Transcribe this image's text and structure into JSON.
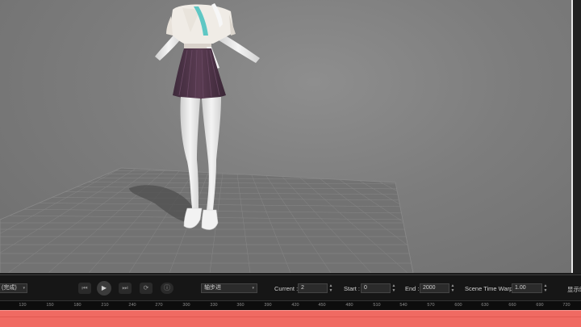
{
  "controls": {
    "mode_value": "(完成)",
    "interp_value": "轴步进",
    "current_label": "Current :",
    "current_value": "2",
    "start_label": "Start :",
    "start_value": "0",
    "end_label": "End :",
    "end_value": "2000",
    "warp_label": "Scene Time Warp",
    "warp_value": "1.00",
    "display_label": "显示时"
  },
  "icons": {
    "skip_back": "skip-back-icon",
    "play": "play-icon",
    "skip_forward": "skip-forward-icon",
    "loop": "loop-icon",
    "info": "info-icon"
  },
  "ruler": {
    "ticks": [
      "120",
      "150",
      "180",
      "210",
      "240",
      "270",
      "300",
      "330",
      "360",
      "390",
      "420",
      "450",
      "480",
      "510",
      "540",
      "570",
      "600",
      "630",
      "660",
      "690",
      "720"
    ]
  },
  "colors": {
    "track": "#f06a62",
    "accent_top": "#e8e8e8"
  }
}
